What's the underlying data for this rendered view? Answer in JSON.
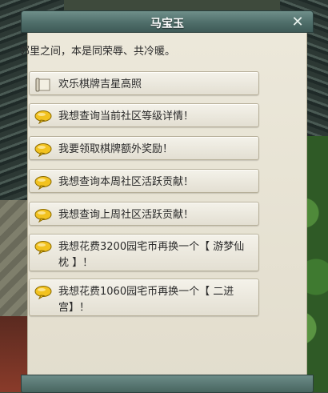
{
  "dialog": {
    "title": "马宝玉",
    "close_symbol": "✕",
    "intro": "邻里之间，本是同荣辱、共冷暖。"
  },
  "options": [
    {
      "label": "欢乐棋牌吉星高照",
      "icon": "scroll-icon"
    },
    {
      "label": "我想查询当前社区等级详情！",
      "icon": "speech-bubble-icon"
    },
    {
      "label": "我要领取棋牌额外奖励！",
      "icon": "speech-bubble-icon"
    },
    {
      "label": "我想查询本周社区活跃贡献！",
      "icon": "speech-bubble-icon"
    },
    {
      "label": "我想查询上周社区活跃贡献！",
      "icon": "speech-bubble-icon"
    },
    {
      "label": "我想花费3200园宅币再换一个【 游梦仙枕 】！",
      "icon": "speech-bubble-icon"
    },
    {
      "label": "我想花费1060园宅币再换一个【 二进宫】！",
      "icon": "speech-bubble-icon"
    }
  ],
  "colors": {
    "titlebar": "#4f6e6a",
    "panel": "#e8e4d6",
    "bubble": "#f0c020"
  }
}
